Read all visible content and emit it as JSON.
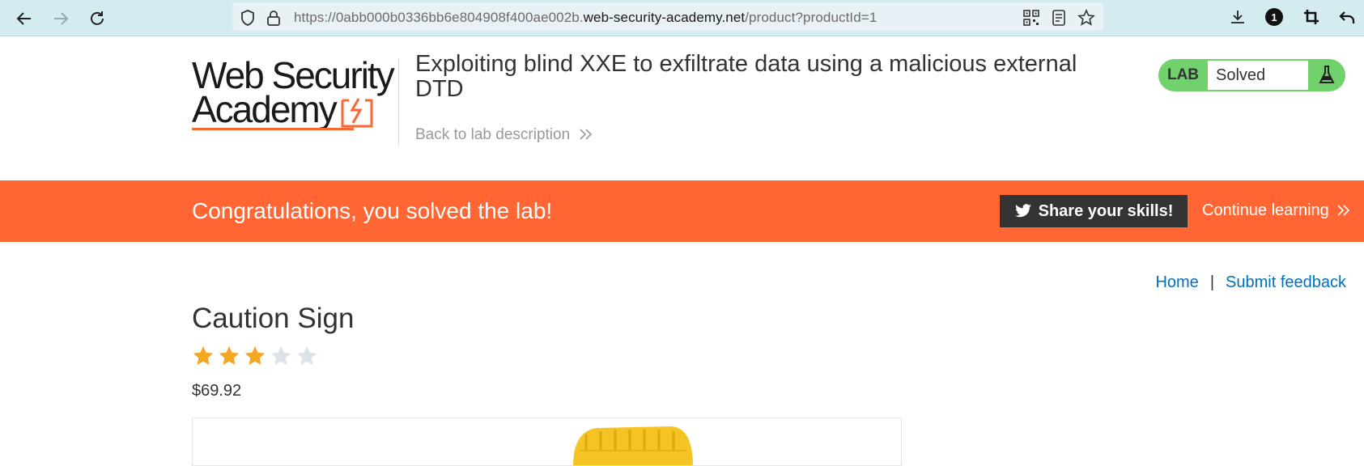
{
  "browser": {
    "url_prefix": "https://0abb000b0336bb6e804908f400ae002b.",
    "url_host": "web-security-academy.net",
    "url_path": "/product?productId=1",
    "extension_badge": "1"
  },
  "header": {
    "logo_line1": "Web Security",
    "logo_line2": "Academy",
    "lab_title": "Exploiting blind XXE to exfiltrate data using a malicious external DTD",
    "back_link": "Back to lab description",
    "lab_label": "LAB",
    "lab_status": "Solved"
  },
  "banner": {
    "message": "Congratulations, you solved the lab!",
    "share_label": "Share your skills!",
    "continue_label": "Continue learning"
  },
  "nav": {
    "home": "Home",
    "separator": "|",
    "feedback": "Submit feedback"
  },
  "product": {
    "name": "Caution Sign",
    "rating": 3,
    "rating_max": 5,
    "price": "$69.92"
  },
  "colors": {
    "accent_orange": "#ff6633",
    "lab_green": "#70d16d",
    "link_blue": "#0071bc",
    "star_gold": "#f5a623",
    "star_grey": "#dde3e6"
  }
}
